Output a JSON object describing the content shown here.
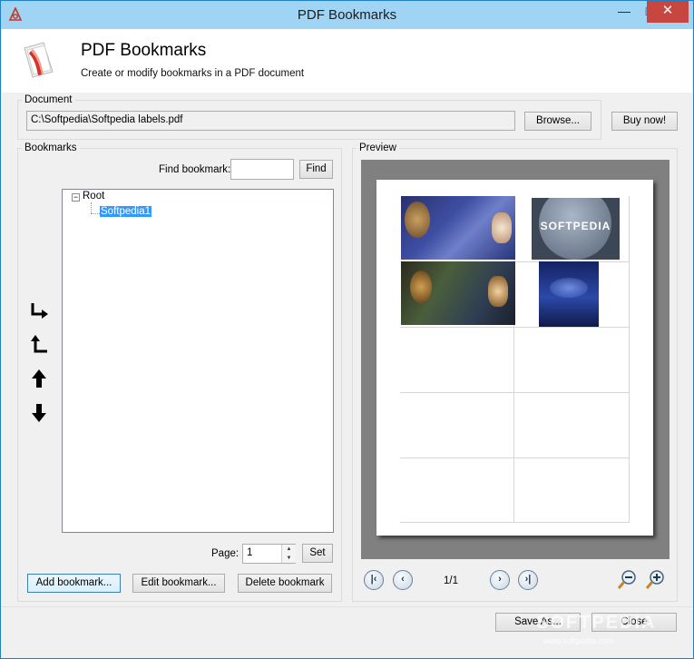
{
  "window": {
    "title": "PDF Bookmarks",
    "min_glyph": "—",
    "max_glyph": "□",
    "close_glyph": "✕"
  },
  "header": {
    "title": "PDF Bookmarks",
    "subtitle": "Create or modify bookmarks in a PDF document"
  },
  "document": {
    "group_label": "Document",
    "path": "C:\\Softpedia\\Softpedia labels.pdf",
    "browse_label": "Browse...",
    "buy_label": "Buy now!"
  },
  "bookmarks": {
    "group_label": "Bookmarks",
    "find_label": "Find bookmark:",
    "find_value": "",
    "find_button": "Find",
    "tree": {
      "root": "Root",
      "child": "Softpedia1"
    },
    "page_label": "Page:",
    "page_value": "1",
    "set_button": "Set",
    "add_button": "Add bookmark...",
    "edit_button": "Edit bookmark...",
    "delete_button": "Delete bookmark"
  },
  "preview": {
    "group_label": "Preview",
    "page_count": "1/1",
    "thumb_text": "SOFTPEDIA"
  },
  "footer": {
    "save_as": "Save As...",
    "close": "Close"
  },
  "watermark": {
    "brand": "SOFTPEDIA",
    "url": "www.softpedia.com"
  },
  "colors": {
    "titlebar": "#9fd4f5",
    "close": "#c7463f",
    "selection": "#3399ff",
    "preview_bg": "#808080"
  },
  "icons": [
    "app-icon",
    "pdf-logo-icon",
    "indent-right-icon",
    "outdent-left-icon",
    "move-up-icon",
    "move-down-icon",
    "first-page-icon",
    "prev-page-icon",
    "next-page-icon",
    "last-page-icon",
    "zoom-out-icon",
    "zoom-in-icon"
  ]
}
